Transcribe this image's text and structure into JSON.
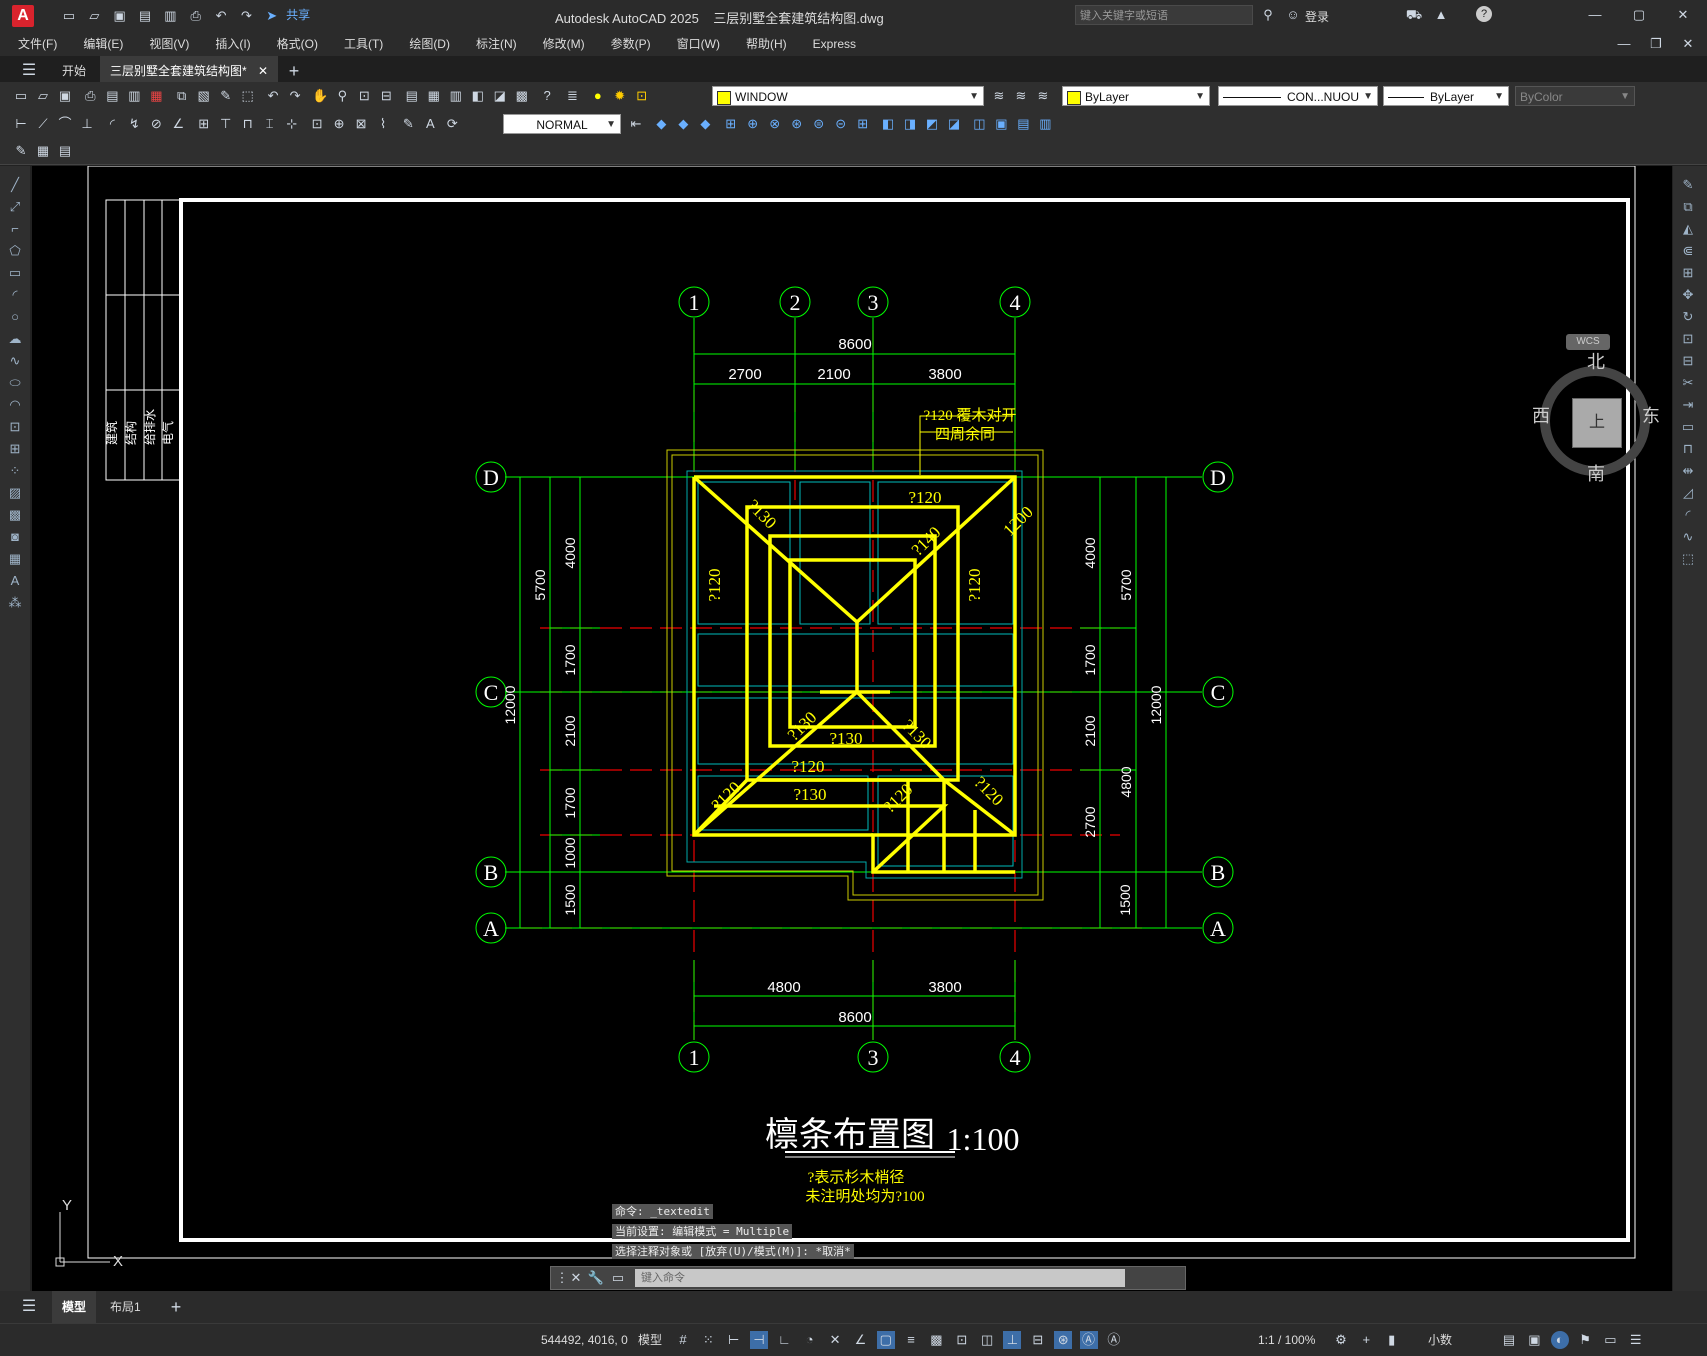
{
  "app": {
    "title": "Autodesk AutoCAD 2025",
    "file_title": "三层别墅全套建筑结构图.dwg",
    "search_placeholder": "键入关键字或短语",
    "login": "登录",
    "share": "共享"
  },
  "menu": [
    "文件(F)",
    "编辑(E)",
    "视图(V)",
    "插入(I)",
    "格式(O)",
    "工具(T)",
    "绘图(D)",
    "标注(N)",
    "修改(M)",
    "参数(P)",
    "窗口(W)",
    "帮助(H)",
    "Express"
  ],
  "tabs": {
    "start": "开始",
    "doc": "三层别墅全套建筑结构图*"
  },
  "toolbar": {
    "layer_name": "WINDOW",
    "color": "ByLayer",
    "linetype": "CON...NUOU",
    "lineweight": "ByLayer",
    "plotstyle": "ByColor",
    "textstyle": "NORMAL"
  },
  "viewcube": {
    "north": "北",
    "south": "南",
    "east": "东",
    "west": "西",
    "top": "上",
    "wcs": "WCS"
  },
  "title_block": [
    "建筑",
    "结构",
    "给排水",
    "电气"
  ],
  "drawing": {
    "axes_x": [
      "1",
      "2",
      "3",
      "4"
    ],
    "axes_y": [
      "D",
      "C",
      "B",
      "A"
    ],
    "dims_top_total": "8600",
    "dims_top": [
      "2700",
      "2100",
      "3800"
    ],
    "dims_bottom": [
      "4800",
      "3800"
    ],
    "dims_bottom_total": "8600",
    "dims_left_outer": [
      "5700",
      "12000"
    ],
    "dims_left_inner": [
      "4000",
      "1700",
      "2100",
      "1700",
      "1000",
      "1500"
    ],
    "dims_right_inner": [
      "4000",
      "1700",
      "2100",
      "2700",
      "1500"
    ],
    "dims_right_outer": [
      "5700",
      "12000",
      "4800"
    ],
    "note1": "?120 覆木对开",
    "note2": "四周余同",
    "purlins": [
      "?120",
      "?130",
      "?140",
      "?120",
      "?120",
      "?130",
      "?130",
      "?130",
      "?120",
      "?120",
      "?130",
      "?120",
      "?120",
      "?120"
    ],
    "note_diag": "1200",
    "title": "檩条布置图",
    "scale": "1:100",
    "legend1": "?表示杉木梢径",
    "legend2": "未注明处均为?100"
  },
  "command": {
    "history": [
      "命令:  _textedit",
      "当前设置: 编辑模式 = Multiple",
      "选择注释对象或 [放弃(U)/模式(M)]: *取消*"
    ],
    "placeholder": "键入命令"
  },
  "bottom_tabs": {
    "model": "模型",
    "layout1": "布局1"
  },
  "status": {
    "coords": "544492, 4016, 0",
    "model": "模型",
    "scale": "1:1 / 100%",
    "units": "小数"
  }
}
